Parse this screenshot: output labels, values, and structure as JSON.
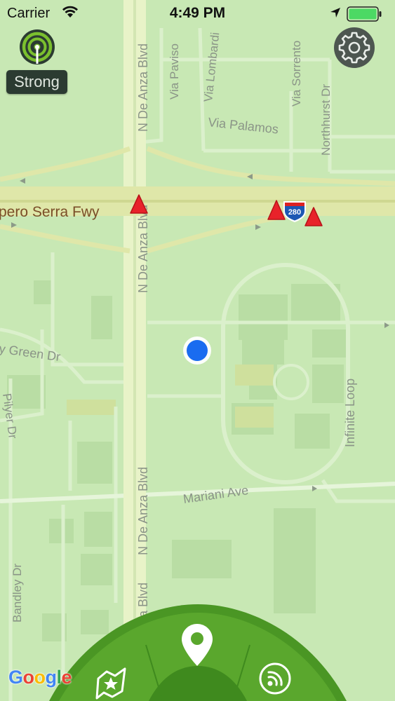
{
  "status_bar": {
    "carrier": "Carrier",
    "time": "4:49 PM",
    "battery_color": "#4cd964"
  },
  "signal": {
    "label": "Strong",
    "icon": "signal-strength-icon",
    "color": "#7bbf2e"
  },
  "settings": {
    "icon": "gear-icon"
  },
  "map": {
    "roads": {
      "freeway": "pero Serra Fwy",
      "de_anza_upper": "N De Anza Blvd",
      "de_anza_mid": "N De Anza Blvd",
      "de_anza_low": "N De Anza Blvd",
      "de_anza_bottom": "Anza Blvd",
      "via_paviso": "Via Paviso",
      "via_lombardi": "Via Lombardi",
      "via_sorrento": "Via Sorrento",
      "northhurst": "Northhurst Dr",
      "via_palamos": "Via Palamos",
      "green_dr": "y Green Dr",
      "infinite_loop": "Infinite Loop",
      "mariani": "Mariani Ave",
      "bandley": "Bandley Dr",
      "left_edge": "Pilyer Dr"
    },
    "shield": "280",
    "base_color": "#c8e8b4",
    "hazard_color": "#e8222a",
    "location_color": "#1a6cf0"
  },
  "google_logo": [
    "G",
    "o",
    "o",
    "g",
    "l",
    "e"
  ],
  "dock": {
    "color": "#58a32b",
    "left_icon": "map-star-icon",
    "center_icon": "location-pin-icon",
    "right_icon": "broadcast-icon"
  }
}
